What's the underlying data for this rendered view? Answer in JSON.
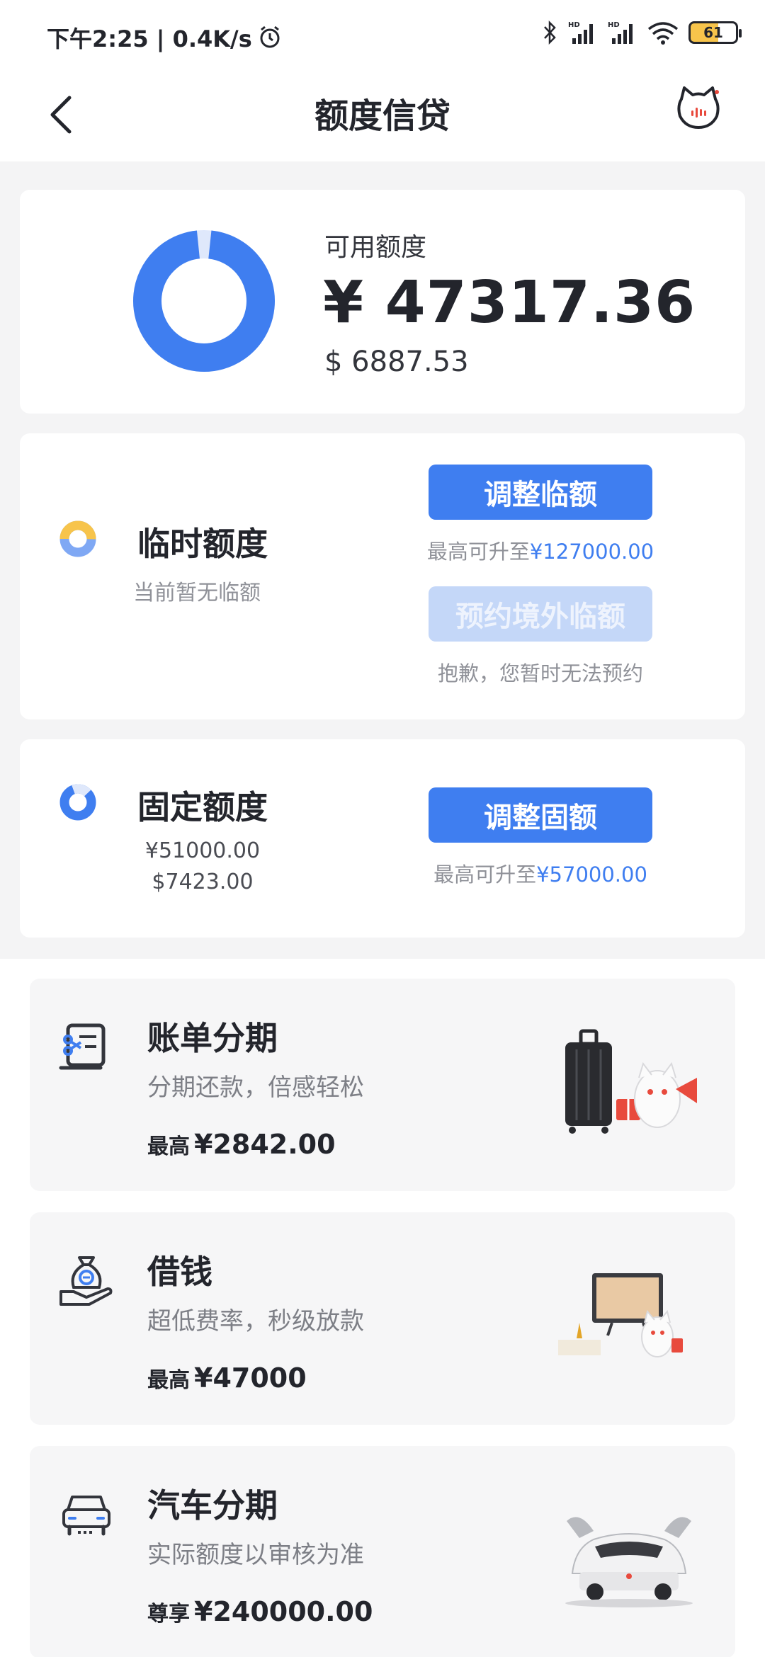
{
  "status_bar": {
    "time": "下午2:25 | 0.4K/s",
    "battery": "61",
    "icons": [
      "alarm-icon",
      "bluetooth-icon",
      "hd-signal-icon",
      "hd-signal-icon",
      "wifi-icon",
      "battery-icon"
    ]
  },
  "header": {
    "title": "额度信贷"
  },
  "available": {
    "label": "可用额度",
    "amount": "¥ 47317.36",
    "usd": "$ 6887.53"
  },
  "temporary": {
    "title": "临时额度",
    "subtitle": "当前暂无临额",
    "adjust_button": "调整临额",
    "max_prefix": "最高可升至",
    "max_value": "¥127000.00",
    "reserve_button": "预约境外临额",
    "reserve_note": "抱歉，您暂时无法预约"
  },
  "fixed": {
    "title": "固定额度",
    "cny": "¥51000.00",
    "usd": "$7423.00",
    "adjust_button": "调整固额",
    "max_prefix": "最高可升至",
    "max_value": "¥57000.00"
  },
  "services": [
    {
      "title": "账单分期",
      "subtitle": "分期还款，倍感轻松",
      "limit_label": "最高",
      "limit_value": "¥2842.00",
      "icon": "bill-installment-icon"
    },
    {
      "title": "借钱",
      "subtitle": "超低费率，秒级放款",
      "limit_label": "最高",
      "limit_value": "¥47000",
      "icon": "money-bag-icon"
    },
    {
      "title": "汽车分期",
      "subtitle": "实际额度以审核为准",
      "limit_label": "尊享",
      "limit_value": "¥240000.00",
      "icon": "car-icon"
    }
  ],
  "colors": {
    "accent": "#3f7ef0",
    "accent_disabled": "#c4d7f8",
    "temp_quota": "#f7c44b"
  }
}
